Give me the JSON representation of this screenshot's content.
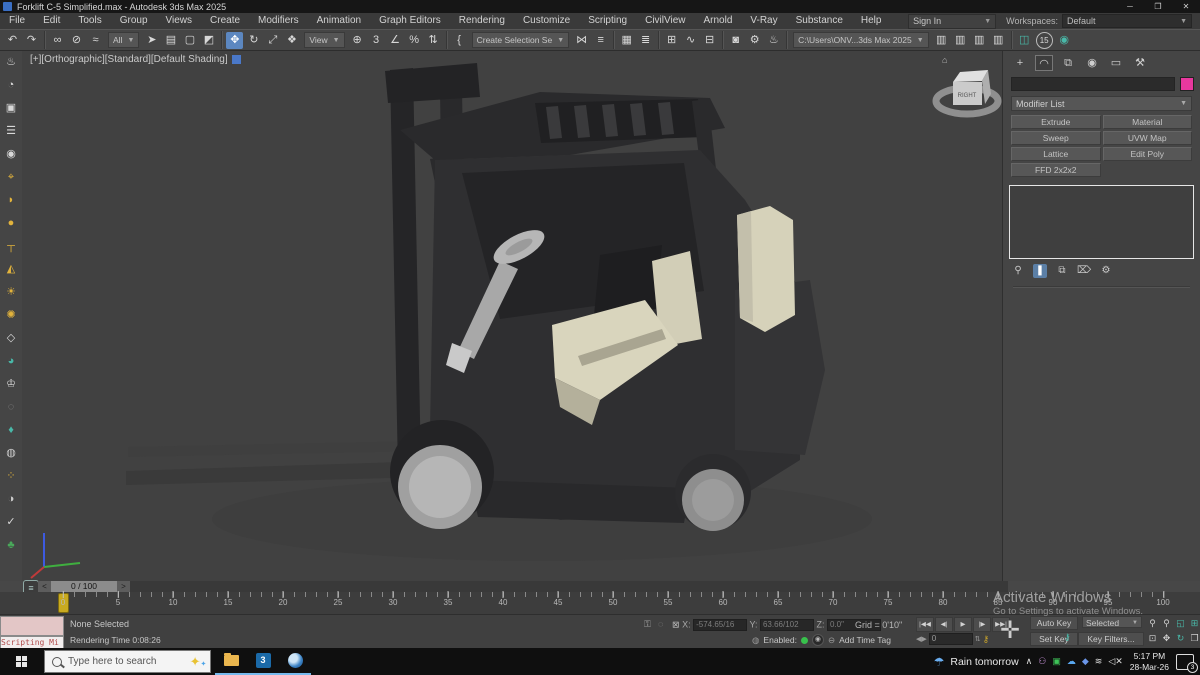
{
  "window": {
    "title": "Forklift C-5 Simplified.max - Autodesk 3ds Max 2025",
    "controls": {
      "minimize": "─",
      "maximize": "❐",
      "close": "✕"
    }
  },
  "menubar": {
    "items": [
      "File",
      "Edit",
      "Tools",
      "Group",
      "Views",
      "Create",
      "Modifiers",
      "Animation",
      "Graph Editors",
      "Rendering",
      "Customize",
      "Scripting",
      "CivilView",
      "Arnold",
      "V-Ray",
      "Substance",
      "Help"
    ],
    "sign_in": "Sign In",
    "workspaces_label": "Workspaces:",
    "workspace_value": "Default"
  },
  "toolbar": {
    "items": [
      {
        "t": "i",
        "n": "undo-icon",
        "g": "↶"
      },
      {
        "t": "i",
        "n": "redo-icon",
        "g": "↷"
      },
      {
        "t": "sep"
      },
      {
        "t": "i",
        "n": "select-link-icon",
        "g": "∞"
      },
      {
        "t": "i",
        "n": "unlink-icon",
        "g": "⊘"
      },
      {
        "t": "i",
        "n": "bind-spacewarp-icon",
        "g": "≈"
      },
      {
        "t": "dd",
        "n": "selection-filter-dropdown",
        "label": "All"
      },
      {
        "t": "i",
        "n": "select-object-icon",
        "g": "➤"
      },
      {
        "t": "i",
        "n": "select-by-name-icon",
        "g": "▤"
      },
      {
        "t": "i",
        "n": "rect-selection-region-icon",
        "g": "▢"
      },
      {
        "t": "i",
        "n": "window-crossing-icon",
        "g": "◩"
      },
      {
        "t": "sep"
      },
      {
        "t": "i",
        "n": "select-move-icon",
        "g": "✥",
        "active": true
      },
      {
        "t": "i",
        "n": "select-rotate-icon",
        "g": "↻"
      },
      {
        "t": "i",
        "n": "select-scale-icon",
        "g": "⤢"
      },
      {
        "t": "i",
        "n": "select-placement-icon",
        "g": "❖"
      },
      {
        "t": "dd",
        "n": "reference-coordinate-dropdown",
        "label": "View"
      },
      {
        "t": "i",
        "n": "use-pivot-center-icon",
        "g": "⊕"
      },
      {
        "t": "i",
        "n": "snap-toggle-icon",
        "g": "3"
      },
      {
        "t": "i",
        "n": "angle-snap-icon",
        "g": "∠"
      },
      {
        "t": "i",
        "n": "percent-snap-icon",
        "g": "%"
      },
      {
        "t": "i",
        "n": "spinner-snap-icon",
        "g": "⇅"
      },
      {
        "t": "sep"
      },
      {
        "t": "i",
        "n": "named-selection-sets-icon",
        "g": "{"
      },
      {
        "t": "dd",
        "n": "selection-set-dropdown",
        "label": "Create Selection Se"
      },
      {
        "t": "i",
        "n": "mirror-icon",
        "g": "⋈"
      },
      {
        "t": "i",
        "n": "align-icon",
        "g": "≡"
      },
      {
        "t": "sep"
      },
      {
        "t": "i",
        "n": "scene-explorer-icon",
        "g": "▦"
      },
      {
        "t": "i",
        "n": "layer-explorer-icon",
        "g": "≣"
      },
      {
        "t": "sep"
      },
      {
        "t": "i",
        "n": "ribbon-icon",
        "g": "⊞"
      },
      {
        "t": "i",
        "n": "curve-editor-icon",
        "g": "∿"
      },
      {
        "t": "i",
        "n": "schematic-view-icon",
        "g": "⊟"
      },
      {
        "t": "sep"
      },
      {
        "t": "i",
        "n": "material-editor-icon",
        "g": "◙"
      },
      {
        "t": "i",
        "n": "render-setup-icon",
        "g": "⚙"
      },
      {
        "t": "i",
        "n": "render-frame-window-icon",
        "g": "♨"
      },
      {
        "t": "sep"
      },
      {
        "t": "dd",
        "n": "project-folder-dropdown",
        "label": "C:\\Users\\ONV...3ds Max 2025"
      },
      {
        "t": "i",
        "n": "import-scene-icon",
        "g": "▥"
      },
      {
        "t": "i",
        "n": "save-scene-icon",
        "g": "▥"
      },
      {
        "t": "i",
        "n": "merge-scene-icon",
        "g": "▥"
      },
      {
        "t": "i",
        "n": "export-scene-icon",
        "g": "▥"
      },
      {
        "t": "sep"
      },
      {
        "t": "i",
        "n": "saved-frame-icon",
        "g": "◫",
        "c": "#49b8a8"
      },
      {
        "t": "badge",
        "n": "badge-15-icon",
        "label": "15"
      },
      {
        "t": "i",
        "n": "vray-render-toolbar-icon",
        "g": "◉",
        "c": "#49b8a8"
      }
    ]
  },
  "left_toolbar": {
    "icons": [
      {
        "n": "vray-teapot-icon",
        "g": "♨",
        "c": "#d8d8d8"
      },
      {
        "n": "vray-camera-icon",
        "g": "◔",
        "c": "#d8d8d8"
      },
      {
        "n": "vray-framebuffer-icon",
        "g": "▣",
        "c": "#d8d8d8"
      },
      {
        "n": "vray-settings-icon",
        "g": "☰",
        "c": "#d8d8d8"
      },
      {
        "n": "vray-physcam-icon",
        "g": "◉",
        "c": "#d8d8d8"
      },
      {
        "n": "vray-light-icon",
        "g": "⌖",
        "c": "#e2b33c"
      },
      {
        "n": "vray-dome-light-icon",
        "g": "◗",
        "c": "#e2b33c"
      },
      {
        "n": "vray-sphere-light-icon",
        "g": "●",
        "c": "#e2b33c"
      },
      {
        "n": "vray-plane-light-icon",
        "g": "┬",
        "c": "#e2b33c"
      },
      {
        "n": "vray-mesh-light-icon",
        "g": "◭",
        "c": "#e2b33c"
      },
      {
        "n": "vray-sun-icon",
        "g": "☀",
        "c": "#e2b33c"
      },
      {
        "n": "vray-ies-light-icon",
        "g": "✺",
        "c": "#e2b33c"
      },
      {
        "n": "vray-proxy-icon",
        "g": "◇",
        "c": "#d8d8d8"
      },
      {
        "n": "vray-sphere-icon",
        "g": "◕",
        "c": "#49b8a8"
      },
      {
        "n": "vray-fur-icon",
        "g": "♔",
        "c": "#d8d8d8"
      },
      {
        "n": "vray-clipper-icon",
        "g": "◌",
        "c": "#8a8a8a"
      },
      {
        "n": "vray-volume-icon",
        "g": "♦",
        "c": "#49b8a8"
      },
      {
        "n": "vray-matte-sphere-icon",
        "g": "◍",
        "c": "#cccccc"
      },
      {
        "n": "vray-scatter-icon",
        "g": "⁘",
        "c": "#e2b33c"
      },
      {
        "n": "vray-material-icon",
        "g": "◑",
        "c": "#cccccc"
      },
      {
        "n": "vray-check-icon",
        "g": "✓",
        "c": "#d8d8d8"
      },
      {
        "n": "vray-vegetation-icon",
        "g": "♣",
        "c": "#49a85a"
      }
    ]
  },
  "viewport": {
    "label": "[+][Orthographic][Standard][Default Shading]",
    "viewcube_face": "RIGHT",
    "home_icon": "⌂"
  },
  "command_panel": {
    "tabs": [
      {
        "n": "tab-create",
        "g": "+"
      },
      {
        "n": "tab-modify",
        "g": "◠",
        "active": true
      },
      {
        "n": "tab-hierarchy",
        "g": "⧉"
      },
      {
        "n": "tab-motion",
        "g": "◉"
      },
      {
        "n": "tab-display",
        "g": "▭"
      },
      {
        "n": "tab-utilities",
        "g": "⚒"
      }
    ],
    "modifier_list_label": "Modifier List",
    "buttons": [
      "Extrude",
      "Material",
      "Sweep",
      "UVW Map",
      "Lattice",
      "Edit Poly",
      "FFD 2x2x2"
    ],
    "swatch_color": "#e8389e",
    "stack_icons": [
      {
        "n": "pin-stack-icon",
        "g": "⚲"
      },
      {
        "n": "show-end-result-icon",
        "g": "❚",
        "active": true
      },
      {
        "n": "make-unique-icon",
        "g": "⧉"
      },
      {
        "n": "remove-modifier-icon",
        "g": "⌦"
      },
      {
        "n": "configure-modifier-sets-icon",
        "g": "⚙"
      }
    ]
  },
  "timeline": {
    "slider_label": "0 / 100",
    "prev_arrow": "<",
    "next_arrow": ">",
    "tick_labels": [
      "0",
      "5",
      "10",
      "15",
      "20",
      "25",
      "30",
      "35",
      "40",
      "45",
      "50",
      "55",
      "60",
      "65",
      "70",
      "75",
      "80",
      "85",
      "90",
      "95",
      "100"
    ],
    "curve_editor_glyph": "≡",
    "help_glyph": "?"
  },
  "status_bar": {
    "mini_listener_label": "Scripting Mi",
    "selection_status": "None Selected",
    "render_time": "Rendering Time  0:08:26",
    "coord_x_label": "X:",
    "coord_x": "-574.65/16",
    "coord_y_label": "Y:",
    "coord_y": "63.66/102",
    "coord_z_label": "Z:",
    "coord_z": "0.0\"",
    "grid": "Grid = 0'10\"",
    "playback": [
      {
        "n": "go-start-button",
        "g": "|◀◀"
      },
      {
        "n": "prev-frame-button",
        "g": "◀|"
      },
      {
        "n": "play-button",
        "g": "▶"
      },
      {
        "n": "next-frame-button",
        "g": "|▶"
      },
      {
        "n": "go-end-button",
        "g": "▶▶|"
      }
    ],
    "enabled_label": "Enabled:",
    "add_time_tag": "Add Time Tag",
    "frame_spinner": "0",
    "auto_key": "Auto Key",
    "set_key": "Set Key",
    "key_mode_dropdown": "Selected",
    "key_filters": "Key Filters...",
    "nav": [
      {
        "n": "zoom-button",
        "g": "⚲",
        "c": "#cfcfcf"
      },
      {
        "n": "zoom-all-button",
        "g": "⚲",
        "c": "#cfcfcf"
      },
      {
        "n": "zoom-extents-button",
        "g": "◱",
        "c": "#49b8a8"
      },
      {
        "n": "zoom-extents-all-button",
        "g": "⊞",
        "c": "#49b8a8"
      },
      {
        "n": "zoom-region-button",
        "g": "⊡",
        "c": "#cfcfcf"
      },
      {
        "n": "pan-button",
        "g": "✥",
        "c": "#cfcfcf"
      },
      {
        "n": "orbit-button",
        "g": "↻",
        "c": "#49b8a8"
      },
      {
        "n": "maximize-viewport-button",
        "g": "❒",
        "c": "#cfcfcf"
      }
    ]
  },
  "watermark": {
    "line1": "Activate Windows",
    "line2": "Go to Settings to activate Windows."
  },
  "taskbar": {
    "search_placeholder": "Type here to search",
    "weather": "Rain tomorrow",
    "tray": [
      {
        "n": "tray-expand-icon",
        "g": "∧",
        "c": "#e0e0e0"
      },
      {
        "n": "tray-person-icon",
        "g": "⚇",
        "c": "#c38fd4"
      },
      {
        "n": "tray-chat-icon",
        "g": "▣",
        "c": "#3ec458"
      },
      {
        "n": "tray-onedrive-icon",
        "g": "☁",
        "c": "#59a7ef"
      },
      {
        "n": "tray-dropbox-icon",
        "g": "◆",
        "c": "#6b96e8"
      },
      {
        "n": "tray-network-icon",
        "g": "≋",
        "c": "#e0e0e0"
      },
      {
        "n": "tray-volume-muted-icon",
        "g": "◁✕",
        "c": "#e0e0e0"
      }
    ],
    "time": "5:17 PM",
    "date": "28-Mar-26",
    "notification_count": "3"
  }
}
